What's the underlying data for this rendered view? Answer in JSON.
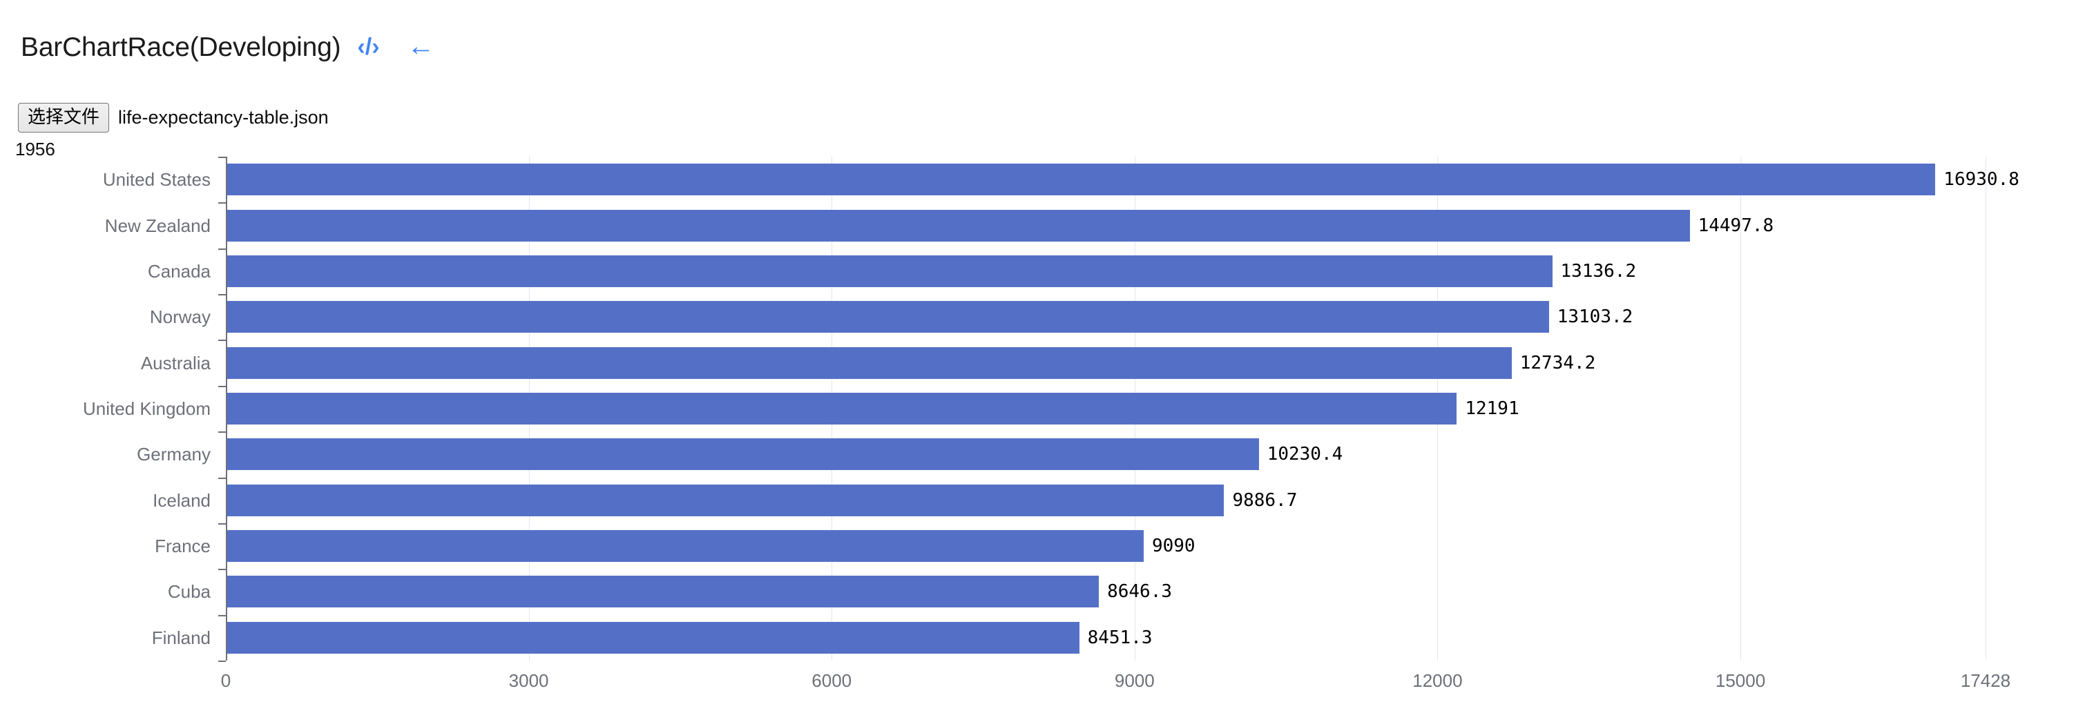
{
  "header": {
    "title": "BarChartRace(Developing)",
    "code_icon": "‹/›",
    "back_icon": "←",
    "accent_color": "#4285f4"
  },
  "file_input": {
    "button_label": "选择文件",
    "file_name": "life-expectancy-table.json"
  },
  "year_label": "1956",
  "chart_data": {
    "type": "bar",
    "orientation": "horizontal",
    "title": "",
    "subtitle": "1956",
    "xlabel": "",
    "ylabel": "",
    "categories": [
      "United States",
      "New Zealand",
      "Canada",
      "Norway",
      "Australia",
      "United Kingdom",
      "Germany",
      "Iceland",
      "France",
      "Cuba",
      "Finland"
    ],
    "values": [
      16930.8,
      14497.8,
      13136.2,
      13103.2,
      12734.2,
      12191,
      10230.4,
      9886.7,
      9090,
      8646.3,
      8451.3
    ],
    "value_labels": [
      "16930.8",
      "14497.8",
      "13136.2",
      "13103.2",
      "12734.2",
      "12191",
      "10230.4",
      "9886.7",
      "9090",
      "8646.3",
      "8451.3"
    ],
    "xticks": [
      0,
      3000,
      6000,
      9000,
      12000,
      15000,
      17428
    ],
    "xtick_labels": [
      "0",
      "3000",
      "6000",
      "9000",
      "12000",
      "15000",
      "17428"
    ],
    "xlim": [
      0,
      17428
    ],
    "grid": true,
    "legend": "none",
    "bar_color": "#5470c6",
    "axis_label_color": "#6e7079",
    "gridline_color": "#e0e6f1"
  }
}
